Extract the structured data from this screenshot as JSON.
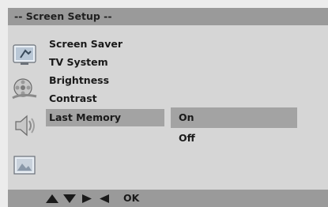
{
  "header": {
    "title": "-- Screen  Setup --"
  },
  "sidebar": {
    "icons": [
      "monitor-icon",
      "film-reel-icon",
      "speaker-icon",
      "picture-icon"
    ]
  },
  "menu": {
    "items": [
      {
        "label": "Screen Saver"
      },
      {
        "label": "TV System"
      },
      {
        "label": "Brightness"
      },
      {
        "label": "Contrast"
      },
      {
        "label": "Last Memory",
        "selected": true
      }
    ]
  },
  "options": {
    "items": [
      {
        "label": "On",
        "selected": true
      },
      {
        "label": "Off"
      }
    ]
  },
  "footer": {
    "nav_icons": [
      "up-arrow-icon",
      "down-arrow-icon",
      "right-arrow-icon",
      "left-arrow-icon"
    ],
    "ok_label": "OK"
  },
  "colors": {
    "background": "#ececec",
    "bar": "#9a9a9a",
    "panel": "#d6d6d6",
    "highlight": "#a3a3a3",
    "text": "#1a1a1a"
  }
}
